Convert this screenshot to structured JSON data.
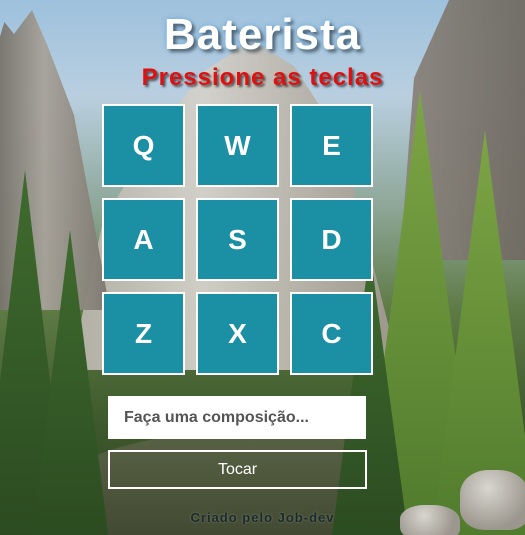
{
  "header": {
    "title": "Baterista",
    "subtitle": "Pressione as teclas"
  },
  "pads": [
    {
      "key": "Q"
    },
    {
      "key": "W"
    },
    {
      "key": "E"
    },
    {
      "key": "A"
    },
    {
      "key": "S"
    },
    {
      "key": "D"
    },
    {
      "key": "Z"
    },
    {
      "key": "X"
    },
    {
      "key": "C"
    }
  ],
  "composition": {
    "placeholder": "Faça uma composição...",
    "value": ""
  },
  "play_button": {
    "label": "Tocar"
  },
  "footer": {
    "credit": "Criado pelo Job-dev"
  },
  "colors": {
    "pad_bg": "#1b8fa3",
    "title": "#ffffff",
    "subtitle": "#e01010"
  }
}
